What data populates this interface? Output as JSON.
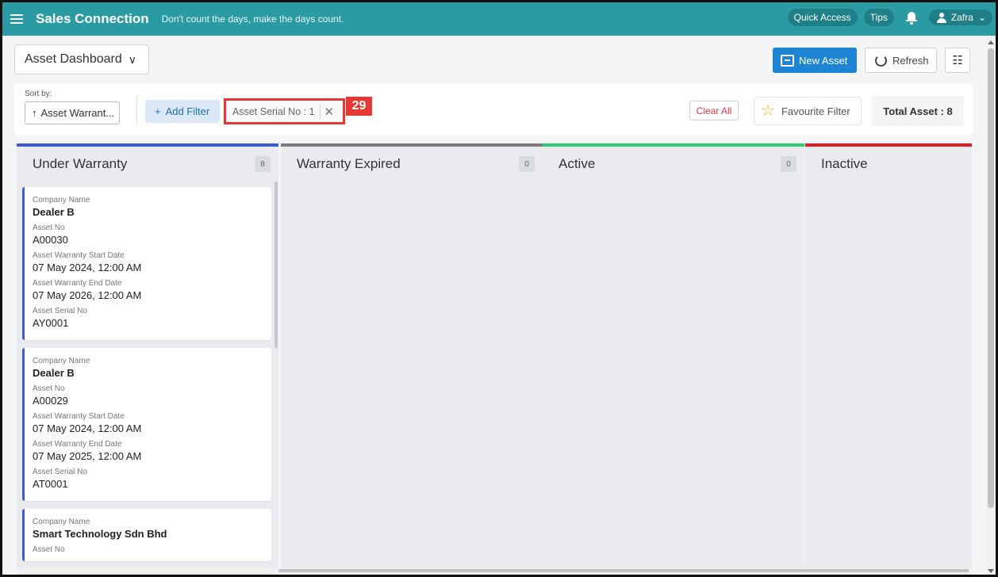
{
  "header": {
    "brand": "Sales Connection",
    "tagline": "Don't count the days, make the days count.",
    "quick_access": "Quick Access",
    "tips": "Tips",
    "user": "Zafra",
    "bg_color": "#2a9ba3"
  },
  "toolbar": {
    "dashboard": "Asset Dashboard",
    "new_asset": "New Asset",
    "refresh": "Refresh"
  },
  "filters": {
    "sort_label": "Sort by:",
    "sort_value": "Asset Warrant...",
    "add_filter": "Add Filter",
    "chip": "Asset Serial No : 1",
    "annotation": "29",
    "clear_all": "Clear All",
    "favourite": "Favourite Filter",
    "total": "Total Asset : 8"
  },
  "columns": [
    {
      "title": "Under Warranty",
      "count": "8",
      "color": "#3b5bdb"
    },
    {
      "title": "Warranty Expired",
      "count": "0",
      "color": "#7a7a7a"
    },
    {
      "title": "Active",
      "count": "0",
      "color": "#2ecc71"
    },
    {
      "title": "Inactive",
      "count": "",
      "color": "#e01b24"
    }
  ],
  "labels": {
    "company": "Company Name",
    "asset_no": "Asset No",
    "start": "Asset Warranty Start Date",
    "end": "Asset Warranty End Date",
    "serial": "Asset Serial No"
  },
  "cards": [
    {
      "company": "Dealer B",
      "asset_no": "A00030",
      "start": "07 May 2024, 12:00 AM",
      "end": "07 May 2026, 12:00 AM",
      "serial": "AY0001"
    },
    {
      "company": "Dealer B",
      "asset_no": "A00029",
      "start": "07 May 2024, 12:00 AM",
      "end": "07 May 2025, 12:00 AM",
      "serial": "AT0001"
    },
    {
      "company": "Smart Technology Sdn Bhd"
    }
  ]
}
